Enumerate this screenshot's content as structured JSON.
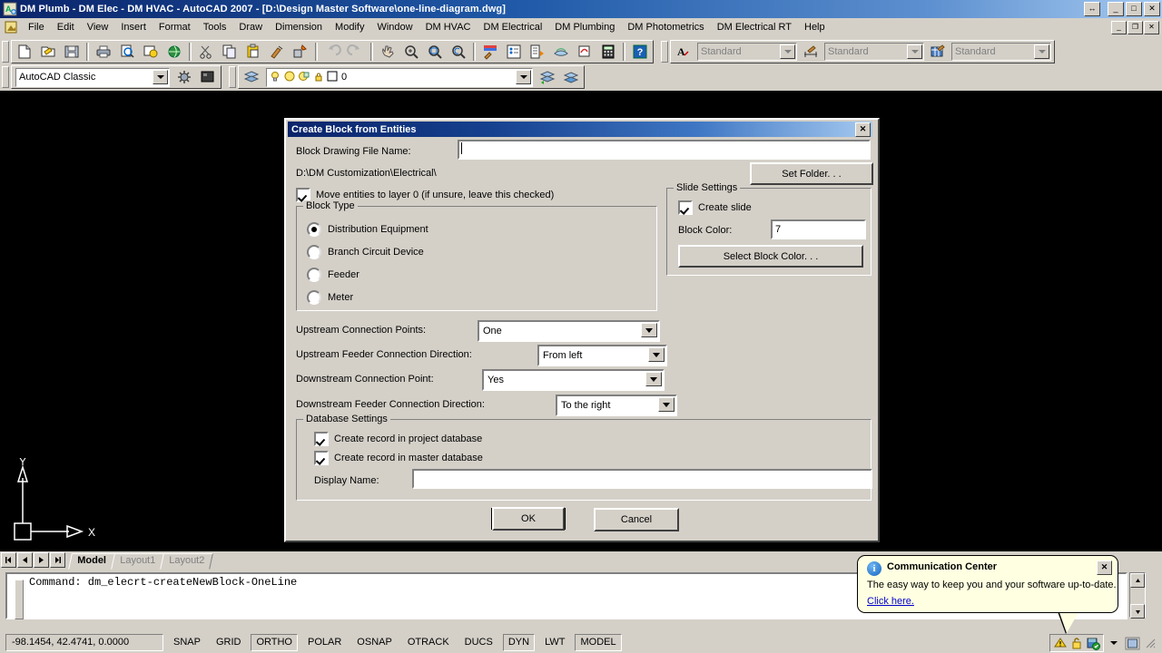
{
  "window": {
    "title": "DM Plumb - DM Elec - DM HVAC - AutoCAD 2007 - [D:\\Design Master Software\\one-line-diagram.dwg]",
    "restore_label": "↔",
    "minimize_label": "_",
    "maximize_label": "□",
    "close_label": "✕",
    "mdi_minimize": "_",
    "mdi_restore": "❐",
    "mdi_close": "✕"
  },
  "menubar": {
    "items": [
      {
        "label": "File"
      },
      {
        "label": "Edit"
      },
      {
        "label": "View"
      },
      {
        "label": "Insert"
      },
      {
        "label": "Format"
      },
      {
        "label": "Tools"
      },
      {
        "label": "Draw"
      },
      {
        "label": "Dimension"
      },
      {
        "label": "Modify"
      },
      {
        "label": "Window"
      },
      {
        "label": "DM HVAC"
      },
      {
        "label": "DM Electrical"
      },
      {
        "label": "DM Plumbing"
      },
      {
        "label": "DM Photometrics"
      },
      {
        "label": "DM Electrical RT"
      },
      {
        "label": "Help"
      }
    ]
  },
  "toolbar_styles": {
    "text_style": "Standard",
    "dim_style": "Standard",
    "table_style": "Standard"
  },
  "workspace": {
    "current": "AutoCAD Classic"
  },
  "layer": {
    "current": "0"
  },
  "layout_tabs": {
    "items": [
      {
        "label": "Model",
        "active": true
      },
      {
        "label": "Layout1",
        "active": false
      },
      {
        "label": "Layout2",
        "active": false
      }
    ]
  },
  "command_window": {
    "history": "Command: dm_elecrt-createNewBlock-OneLine",
    "prompt": ""
  },
  "statusbar": {
    "coordinates": "-98.1454, 42.4741, 0.0000",
    "toggles": [
      {
        "label": "SNAP",
        "on": false
      },
      {
        "label": "GRID",
        "on": false
      },
      {
        "label": "ORTHO",
        "on": true
      },
      {
        "label": "POLAR",
        "on": false
      },
      {
        "label": "OSNAP",
        "on": false
      },
      {
        "label": "OTRACK",
        "on": false
      },
      {
        "label": "DUCS",
        "on": false
      },
      {
        "label": "DYN",
        "on": true
      },
      {
        "label": "LWT",
        "on": false
      },
      {
        "label": "MODEL",
        "on": true
      }
    ]
  },
  "dialog": {
    "title": "Create Block from Entities",
    "close_label": "✕",
    "block_file_name_label": "Block Drawing File Name:",
    "block_file_name_value": "",
    "folder_path": "D:\\DM Customization\\Electrical\\",
    "set_folder_label": "Set Folder. . .",
    "move_entities_label": "Move entities to layer 0 (if unsure, leave this checked)",
    "move_entities_checked": true,
    "block_type": {
      "legend": "Block Type",
      "options": [
        {
          "label": "Distribution Equipment",
          "selected": true
        },
        {
          "label": "Branch Circuit Device",
          "selected": false
        },
        {
          "label": "Feeder",
          "selected": false
        },
        {
          "label": "Meter",
          "selected": false
        }
      ]
    },
    "slide_settings": {
      "legend": "Slide Settings",
      "create_slide_label": "Create slide",
      "create_slide_checked": true,
      "block_color_label": "Block Color:",
      "block_color_value": "7",
      "select_block_color_label": "Select Block Color. . ."
    },
    "connections": [
      {
        "label": "Upstream Connection Points:",
        "value": "One"
      },
      {
        "label": "Upstream Feeder Connection Direction:",
        "value": "From left"
      },
      {
        "label": "Downstream Connection Point:",
        "value": "Yes"
      },
      {
        "label": "Downstream Feeder Connection Direction:",
        "value": "To the right"
      }
    ],
    "database_settings": {
      "legend": "Database Settings",
      "project_db_label": "Create record in project database",
      "project_db_checked": true,
      "master_db_label": "Create record in master database",
      "master_db_checked": true,
      "display_name_label": "Display Name:",
      "display_name_value": ""
    },
    "ok_label": "OK",
    "cancel_label": "Cancel"
  },
  "balloon": {
    "title": "Communication Center",
    "body": "The easy way to keep you and your software up-to-date.",
    "link": "Click here.",
    "close_label": "✕"
  },
  "ucs": {
    "y_label": "Y",
    "x_label": "X"
  },
  "colors": {
    "face": "#d4d0c8",
    "title_start": "#0a246a",
    "title_end": "#a6caf0",
    "canvas": "#000000",
    "balloon": "#ffffe1",
    "link": "#0000cd"
  }
}
